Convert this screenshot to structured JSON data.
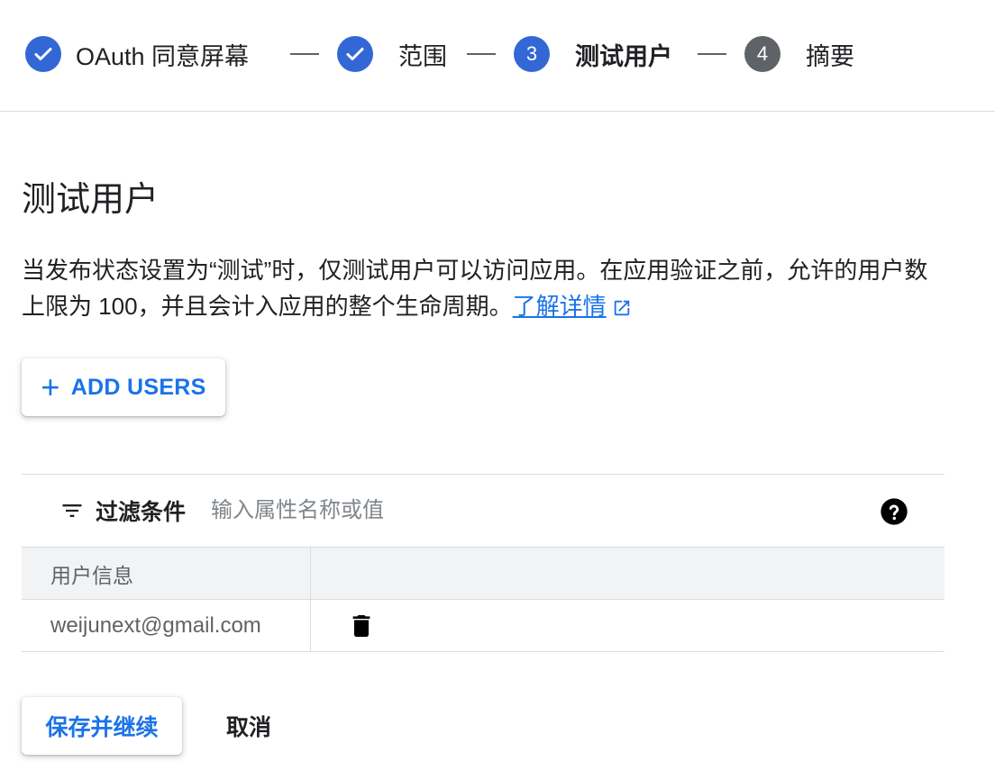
{
  "stepper": {
    "steps": [
      {
        "label": "OAuth 同意屏幕",
        "state": "done",
        "marker": ""
      },
      {
        "label": "范围",
        "state": "done",
        "marker": ""
      },
      {
        "label": "测试用户",
        "state": "active",
        "marker": "3"
      },
      {
        "label": "摘要",
        "state": "pending",
        "marker": "4"
      }
    ]
  },
  "main": {
    "title": "测试用户",
    "description": "当发布状态设置为“测试”时，仅测试用户可以访问应用。在应用验证之前，允许的用户数上限为 100，并且会计入应用的整个生命周期。",
    "learn_more": "了解详情",
    "add_users_label": "ADD USERS"
  },
  "filter": {
    "label": "过滤条件",
    "placeholder": "输入属性名称或值",
    "value": ""
  },
  "table": {
    "columns": [
      "用户信息",
      ""
    ],
    "rows": [
      {
        "email": "weijunext@gmail.com"
      }
    ]
  },
  "actions": {
    "save_label": "保存并继续",
    "cancel_label": "取消"
  },
  "colors": {
    "accent": "#1a73e8",
    "step_done": "#3367d6",
    "step_pending": "#5f6368"
  }
}
